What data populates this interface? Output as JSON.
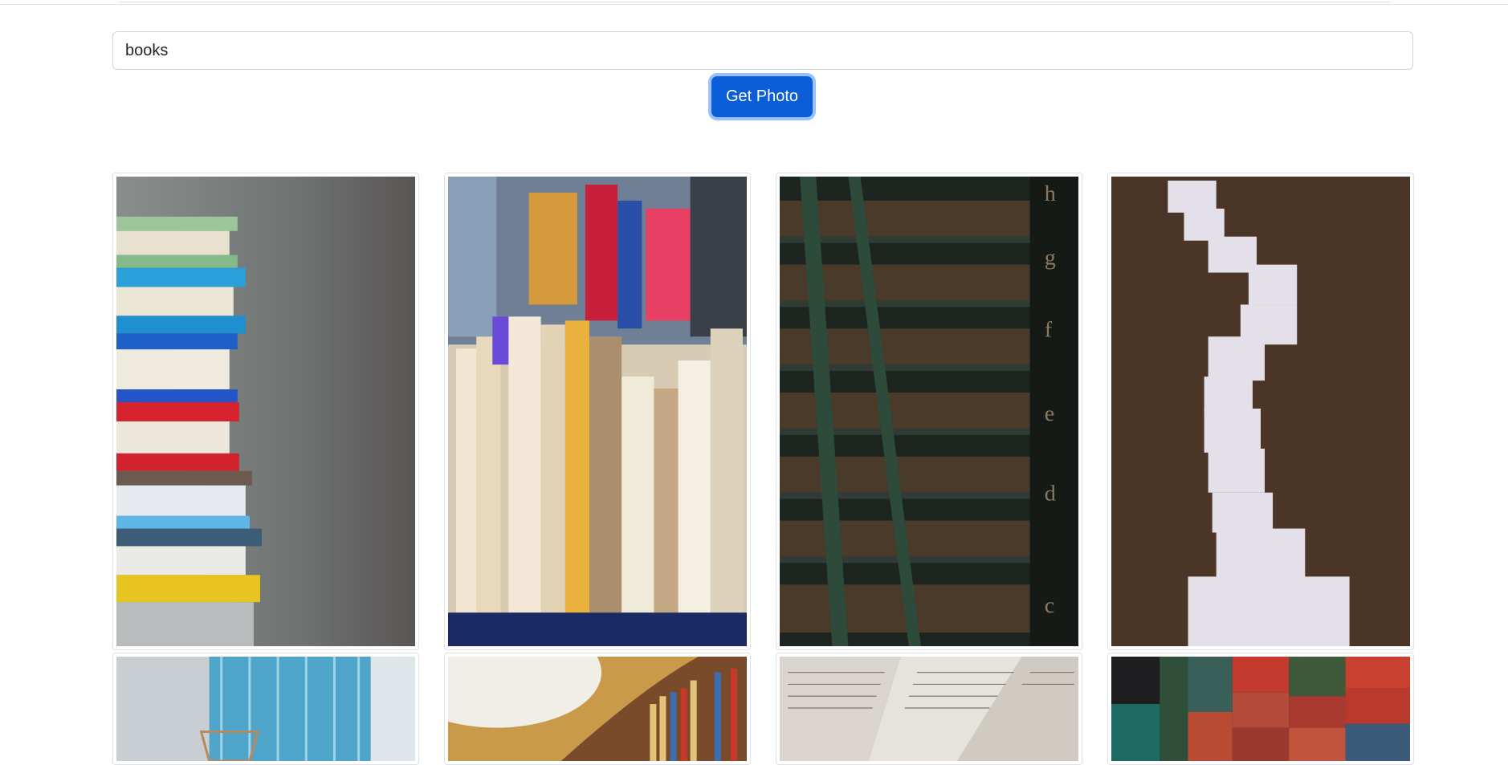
{
  "search": {
    "value": "books"
  },
  "button": {
    "label": "Get Photo"
  },
  "photos": [
    {
      "name": "photo-book-stack",
      "subject": "stack of colorful books"
    },
    {
      "name": "photo-book-row",
      "subject": "row of books on shelf"
    },
    {
      "name": "photo-library-ladder",
      "subject": "library shelves with ladder"
    },
    {
      "name": "photo-book-trail",
      "subject": "open books trail on leaves"
    },
    {
      "name": "photo-curtain-lamp",
      "subject": "blue curtain and lamp"
    },
    {
      "name": "photo-round-library",
      "subject": "curved library shelves"
    },
    {
      "name": "photo-open-pages",
      "subject": "open book pages"
    },
    {
      "name": "photo-old-books",
      "subject": "pile of old red books"
    }
  ],
  "colors": {
    "accent": "#0b5ed7",
    "border": "#dee2e6"
  }
}
